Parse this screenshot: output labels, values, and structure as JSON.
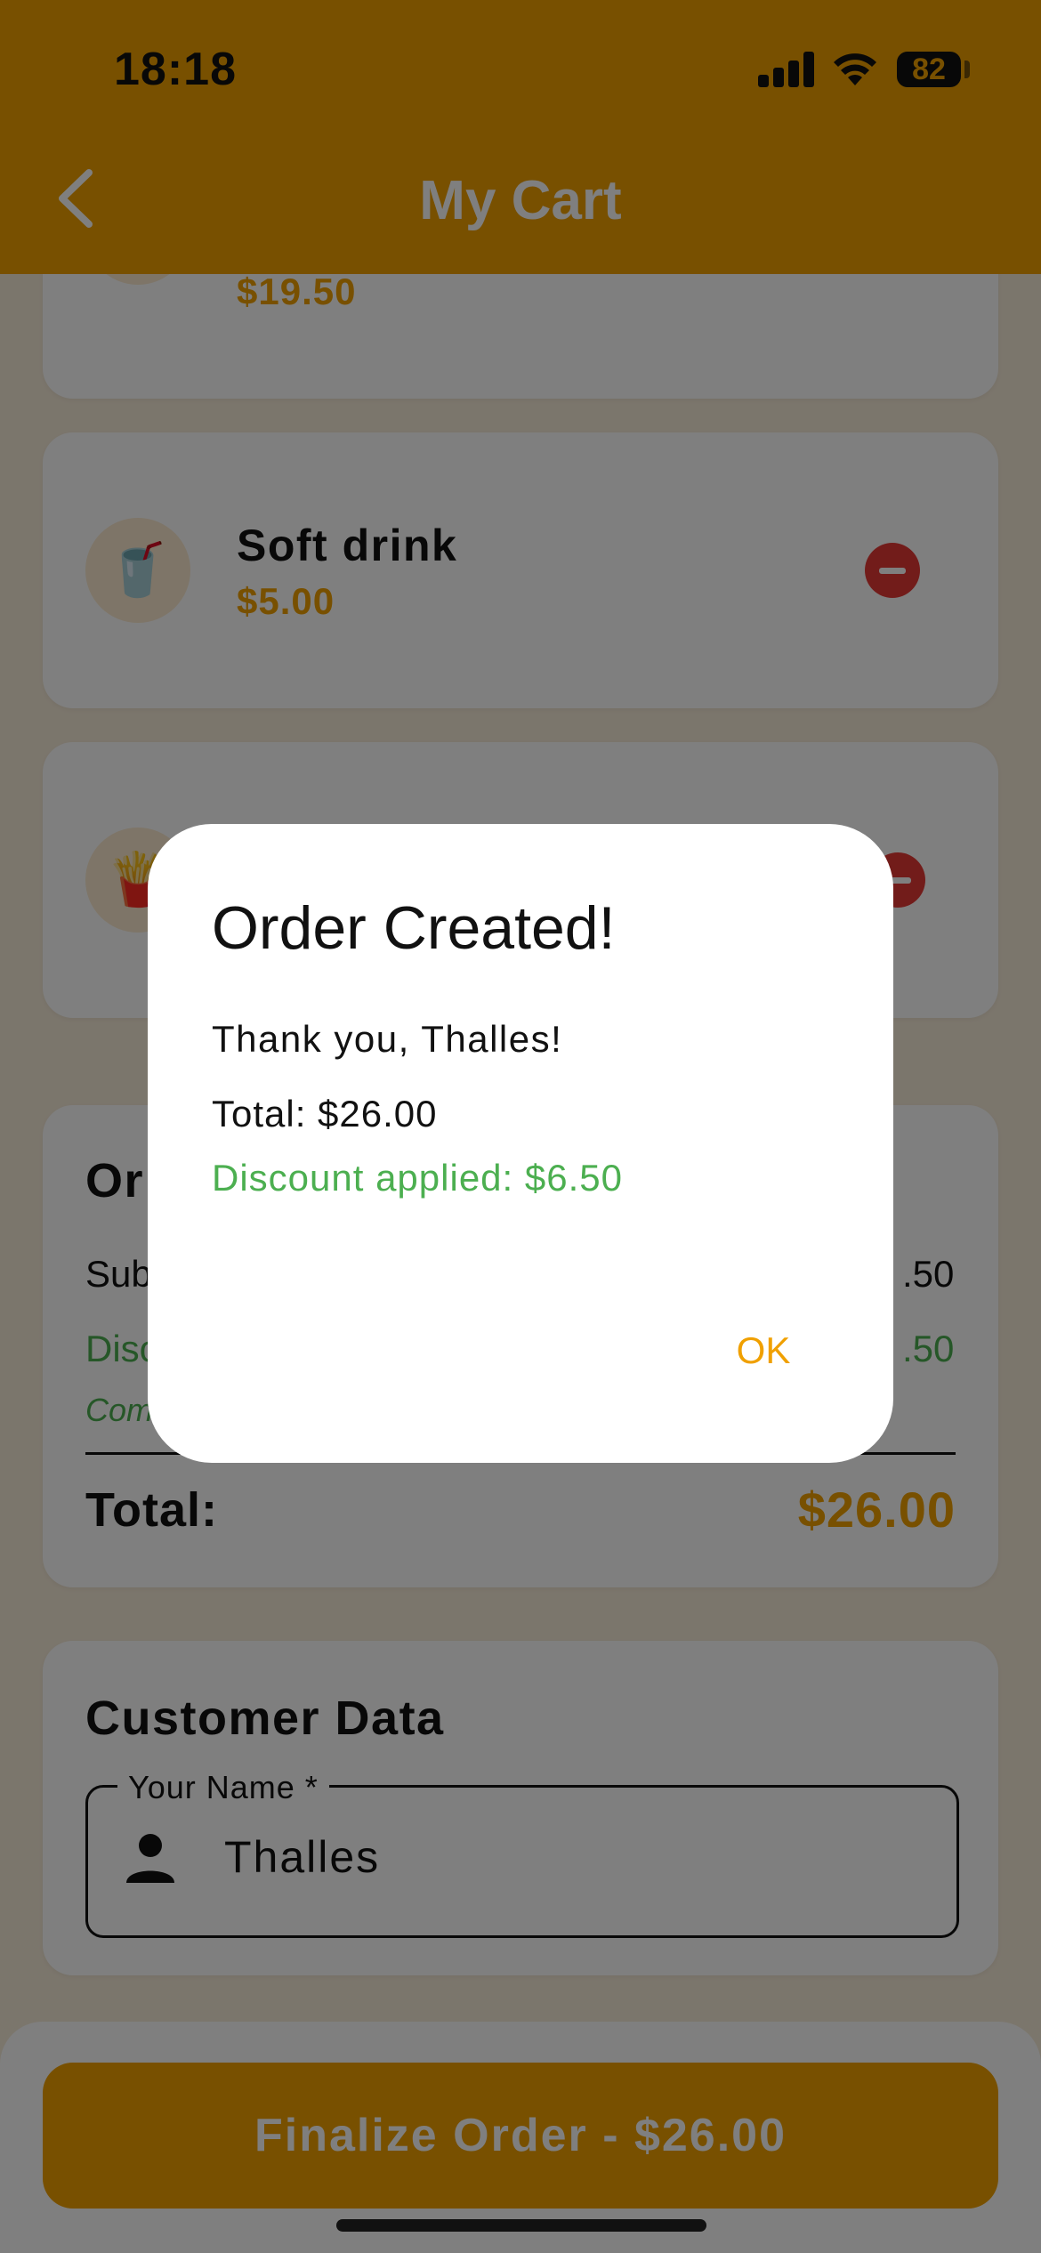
{
  "status_bar": {
    "time": "18:18",
    "battery": "82"
  },
  "header": {
    "title": "My Cart"
  },
  "cart_items": [
    {
      "name": "",
      "price": "$19.50",
      "icon": "burger"
    },
    {
      "name": "Soft drink",
      "price": "$5.00",
      "icon": "soda-cup"
    },
    {
      "name": "",
      "price": "",
      "icon": "fries"
    }
  ],
  "order_summary": {
    "title_fragment": "Or",
    "subtotal_fragment": "Sub",
    "subtotal_value_fragment": ".50",
    "discount_fragment": "Disc",
    "discount_value_fragment": ".50",
    "note_fragment": "Com",
    "total_label": "Total:",
    "total_value": "$26.00"
  },
  "customer": {
    "section_title": "Customer Data",
    "name_label": "Your Name *",
    "name_value": "Thalles"
  },
  "footer": {
    "finalize_label": "Finalize Order - $26.00"
  },
  "dialog": {
    "title": "Order Created!",
    "thanks": "Thank you, Thalles!",
    "total": "Total: $26.00",
    "discount": "Discount applied: $6.50",
    "ok_label": "OK"
  },
  "colors": {
    "accent": "#f0a000",
    "discount_green": "#4caf50",
    "remove_red": "#e53935"
  }
}
